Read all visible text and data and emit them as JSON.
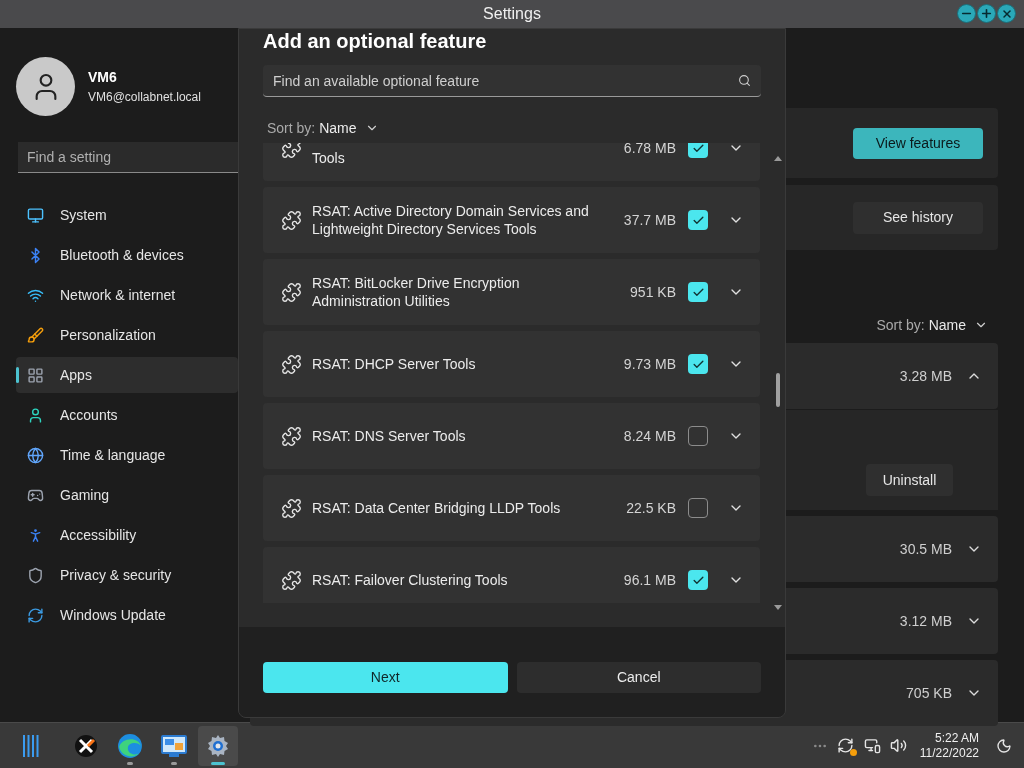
{
  "window": {
    "title": "Settings"
  },
  "account": {
    "name": "VM6",
    "email": "VM6@collabnet.local"
  },
  "sidebar": {
    "search": {
      "placeholder": "Find a setting"
    },
    "items": [
      {
        "label": "System",
        "selected": false
      },
      {
        "label": "Bluetooth & devices",
        "selected": false
      },
      {
        "label": "Network & internet",
        "selected": false
      },
      {
        "label": "Personalization",
        "selected": false
      },
      {
        "label": "Apps",
        "selected": true
      },
      {
        "label": "Accounts",
        "selected": false
      },
      {
        "label": "Time & language",
        "selected": false
      },
      {
        "label": "Gaming",
        "selected": false
      },
      {
        "label": "Accessibility",
        "selected": false
      },
      {
        "label": "Privacy & security",
        "selected": false
      },
      {
        "label": "Windows Update",
        "selected": false
      }
    ]
  },
  "page": {
    "view_features": "View features",
    "see_history": "See history",
    "sort": {
      "label": "Sort by:",
      "value": "Name"
    },
    "installed": [
      {
        "size": "3.28 MB",
        "expanded": true,
        "action": "Uninstall"
      },
      {
        "size": "30.5 MB",
        "expanded": false
      },
      {
        "size": "3.12 MB",
        "expanded": false
      },
      {
        "size": "705 KB",
        "expanded": false
      }
    ]
  },
  "dialog": {
    "title": "Add an optional feature",
    "search": {
      "placeholder": "Find an available optional feature"
    },
    "sort": {
      "label": "Sort by:",
      "value": "Name"
    },
    "features": [
      {
        "name": "Tools",
        "size": "6.78 MB",
        "checked": true
      },
      {
        "name": "RSAT: Active Directory Domain Services and Lightweight Directory Services Tools",
        "size": "37.7 MB",
        "checked": true
      },
      {
        "name": "RSAT: BitLocker Drive Encryption Administration Utilities",
        "size": "951 KB",
        "checked": true
      },
      {
        "name": "RSAT: DHCP Server Tools",
        "size": "9.73 MB",
        "checked": true
      },
      {
        "name": "RSAT: DNS Server Tools",
        "size": "8.24 MB",
        "checked": false
      },
      {
        "name": "RSAT: Data Center Bridging LLDP Tools",
        "size": "22.5 KB",
        "checked": false
      },
      {
        "name": "RSAT: Failover Clustering Tools",
        "size": "96.1 MB",
        "checked": true
      }
    ],
    "buttons": {
      "next": "Next",
      "cancel": "Cancel"
    }
  },
  "taskbar": {
    "apps": [
      {
        "kind": "tool",
        "running": false,
        "selected": false
      },
      {
        "kind": "browser",
        "running": true,
        "selected": false
      },
      {
        "kind": "panel",
        "running": true,
        "selected": false
      },
      {
        "kind": "settings",
        "running": true,
        "selected": true
      }
    ],
    "time": "5:22 AM",
    "date": "11/22/2022"
  }
}
